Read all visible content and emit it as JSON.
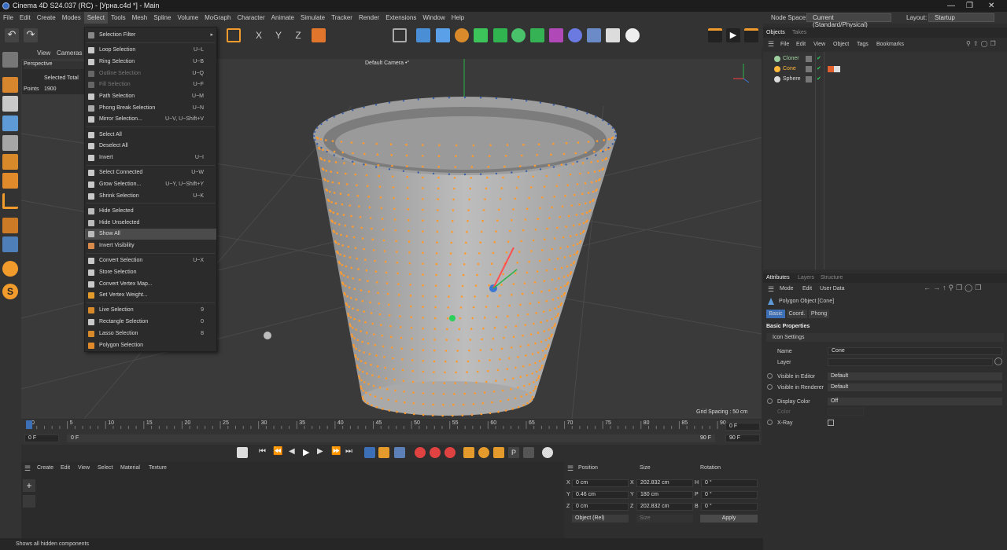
{
  "window": {
    "title": "Cinema 4D S24.037 (RC) - [Урна.c4d *] - Main"
  },
  "menubar": {
    "items": [
      "File",
      "Edit",
      "Create",
      "Modes",
      "Select",
      "Tools",
      "Mesh",
      "Spline",
      "Volume",
      "MoGraph",
      "Character",
      "Animate",
      "Simulate",
      "Tracker",
      "Render",
      "Extensions",
      "Window",
      "Help"
    ],
    "active": "Select",
    "node_space_label": "Node Space:",
    "node_space_value": "Current (Standard/Physical)",
    "layout_label": "Layout:",
    "layout_value": "Startup"
  },
  "viewport": {
    "menu": [
      "View",
      "Cameras"
    ],
    "mode": "Perspective",
    "camera": "Default Camera",
    "camera_mark": "•°",
    "grid_spacing": "Grid Spacing : 50 cm",
    "hud_title": "Selected Total",
    "hud_label": "Points",
    "hud_value": "1900"
  },
  "select_menu": {
    "items": [
      {
        "label": "Selection Filter",
        "shortcut": "",
        "state": "submenu"
      },
      {
        "label": "Loop Selection",
        "shortcut": "U~L",
        "state": "normal"
      },
      {
        "label": "Ring Selection",
        "shortcut": "U~B",
        "state": "normal"
      },
      {
        "label": "Outline Selection",
        "shortcut": "U~Q",
        "state": "disabled"
      },
      {
        "label": "Fill Selection",
        "shortcut": "U~F",
        "state": "disabled"
      },
      {
        "label": "Path Selection",
        "shortcut": "U~M",
        "state": "normal"
      },
      {
        "label": "Phong Break Selection",
        "shortcut": "U~N",
        "state": "normal"
      },
      {
        "label": "Mirror Selection...",
        "shortcut": "U~V, U~Shift+V",
        "state": "normal"
      },
      {
        "label": "Select All",
        "shortcut": "",
        "state": "normal"
      },
      {
        "label": "Deselect All",
        "shortcut": "",
        "state": "normal"
      },
      {
        "label": "Invert",
        "shortcut": "U~I",
        "state": "normal"
      },
      {
        "label": "Select Connected",
        "shortcut": "U~W",
        "state": "normal"
      },
      {
        "label": "Grow Selection...",
        "shortcut": "U~Y, U~Shift+Y",
        "state": "normal"
      },
      {
        "label": "Shrink Selection",
        "shortcut": "U~K",
        "state": "normal"
      },
      {
        "label": "Hide Selected",
        "shortcut": "",
        "state": "normal"
      },
      {
        "label": "Hide Unselected",
        "shortcut": "",
        "state": "normal"
      },
      {
        "label": "Show All",
        "shortcut": "",
        "state": "highlighted"
      },
      {
        "label": "Invert Visibility",
        "shortcut": "",
        "state": "normal"
      },
      {
        "label": "Convert Selection",
        "shortcut": "U~X",
        "state": "normal"
      },
      {
        "label": "Store Selection",
        "shortcut": "",
        "state": "normal"
      },
      {
        "label": "Convert Vertex Map...",
        "shortcut": "",
        "state": "normal"
      },
      {
        "label": "Set Vertex Weight...",
        "shortcut": "",
        "state": "normal"
      },
      {
        "label": "Live Selection",
        "shortcut": "9",
        "state": "normal"
      },
      {
        "label": "Rectangle Selection",
        "shortcut": "0",
        "state": "normal"
      },
      {
        "label": "Lasso Selection",
        "shortcut": "8",
        "state": "normal"
      },
      {
        "label": "Polygon Selection",
        "shortcut": "",
        "state": "normal"
      }
    ]
  },
  "timeline": {
    "ticks": [
      "0",
      "5",
      "10",
      "15",
      "20",
      "25",
      "30",
      "35",
      "40",
      "45",
      "50",
      "55",
      "60",
      "65",
      "70",
      "75",
      "80",
      "85",
      "90"
    ],
    "current_frame": "0 F",
    "start": "0 F",
    "range_start": "0 F",
    "range_end": "90 F",
    "end": "90 F",
    "end_frame": "0 F"
  },
  "material_panel": {
    "menu": [
      "Create",
      "Edit",
      "View",
      "Select",
      "Material",
      "Texture"
    ]
  },
  "coordinates": {
    "headers": [
      "Position",
      "Size",
      "Rotation"
    ],
    "rows": [
      {
        "axis": "X",
        "pos": "0 cm",
        "size_axis": "X",
        "size": "202.832 cm",
        "rot_axis": "H",
        "rot": "0 °"
      },
      {
        "axis": "Y",
        "pos": "0.46 cm",
        "size_axis": "Y",
        "size": "180 cm",
        "rot_axis": "P",
        "rot": "0 °"
      },
      {
        "axis": "Z",
        "pos": "0 cm",
        "size_axis": "Z",
        "size": "202.832 cm",
        "rot_axis": "B",
        "rot": "0 °"
      }
    ],
    "mode": "Object (Rel)",
    "size_mode": "Size",
    "apply": "Apply"
  },
  "objects_panel": {
    "tabs": [
      "Objects",
      "Takes"
    ],
    "menu": [
      "File",
      "Edit",
      "View",
      "Object",
      "Tags",
      "Bookmarks"
    ],
    "objects": [
      {
        "name": "Cloner",
        "color": "#9fd1a0"
      },
      {
        "name": "Cone",
        "color": "#ffb93c"
      },
      {
        "name": "Sphere",
        "color": "#dddddd"
      }
    ]
  },
  "attributes_panel": {
    "tabs": [
      "Attributes",
      "Layers",
      "Structure"
    ],
    "menu": [
      "Mode",
      "Edit",
      "User Data"
    ],
    "object_title": "Polygon Object [Cone]",
    "subtabs": [
      "Basic",
      "Coord.",
      "Phong"
    ],
    "section": "Basic Properties",
    "icon_settings": "Icon Settings",
    "name_label": "Name",
    "name_value": "Cone",
    "layer_label": "Layer",
    "vis_editor_label": "Visible in Editor",
    "vis_editor_value": "Default",
    "vis_render_label": "Visible in Renderer",
    "vis_render_value": "Default",
    "display_color_label": "Display Color",
    "display_color_value": "Off",
    "color_label": "Color",
    "xray_label": "X-Ray"
  },
  "status": {
    "text": "Shows all hidden components"
  },
  "colors": {
    "accent": "#3d6fb6",
    "point": "#ff9a2e",
    "menu_bg": "#2b2b2b"
  }
}
